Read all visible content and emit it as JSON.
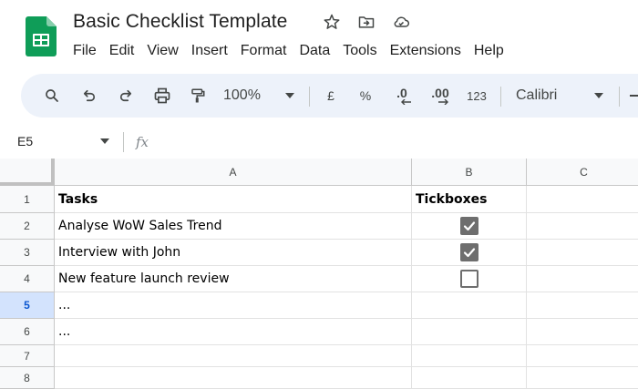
{
  "document": {
    "title": "Basic Checklist Template"
  },
  "menu": [
    "File",
    "Edit",
    "View",
    "Insert",
    "Format",
    "Data",
    "Tools",
    "Extensions",
    "Help"
  ],
  "toolbar": {
    "zoom": "100%",
    "currency": "£",
    "percent": "%",
    "decrease_decimal": ".0",
    "increase_decimal": ".00",
    "number_format": "123",
    "font": "Calibri"
  },
  "formula_bar": {
    "cell_ref": "E5",
    "fx": "fx"
  },
  "columns": [
    "A",
    "B",
    "C"
  ],
  "rows": [
    {
      "num": "1",
      "task": "Tasks",
      "tick": "Tickboxes",
      "header": true
    },
    {
      "num": "2",
      "task": "Analyse WoW Sales Trend",
      "checkbox": "checked"
    },
    {
      "num": "3",
      "task": "Interview with John",
      "checkbox": "checked"
    },
    {
      "num": "4",
      "task": "New feature launch review",
      "checkbox": "unchecked"
    },
    {
      "num": "5",
      "task": "...",
      "selected": true
    },
    {
      "num": "6",
      "task": "..."
    },
    {
      "num": "7",
      "task": ""
    },
    {
      "num": "8",
      "task": ""
    }
  ],
  "icons": {
    "logo": "sheets-logo-icon",
    "star": "star-icon",
    "move": "move-to-folder-icon",
    "cloud": "cloud-status-icon",
    "search": "search-icon",
    "undo": "undo-icon",
    "redo": "redo-icon",
    "print": "print-icon",
    "paint": "paint-format-icon"
  },
  "colors": {
    "sheets_green": "#0f9d58",
    "toolbar_bg": "#edf2fa",
    "selected_row": "#d3e3fd",
    "checkbox": "#6e6e6e"
  }
}
